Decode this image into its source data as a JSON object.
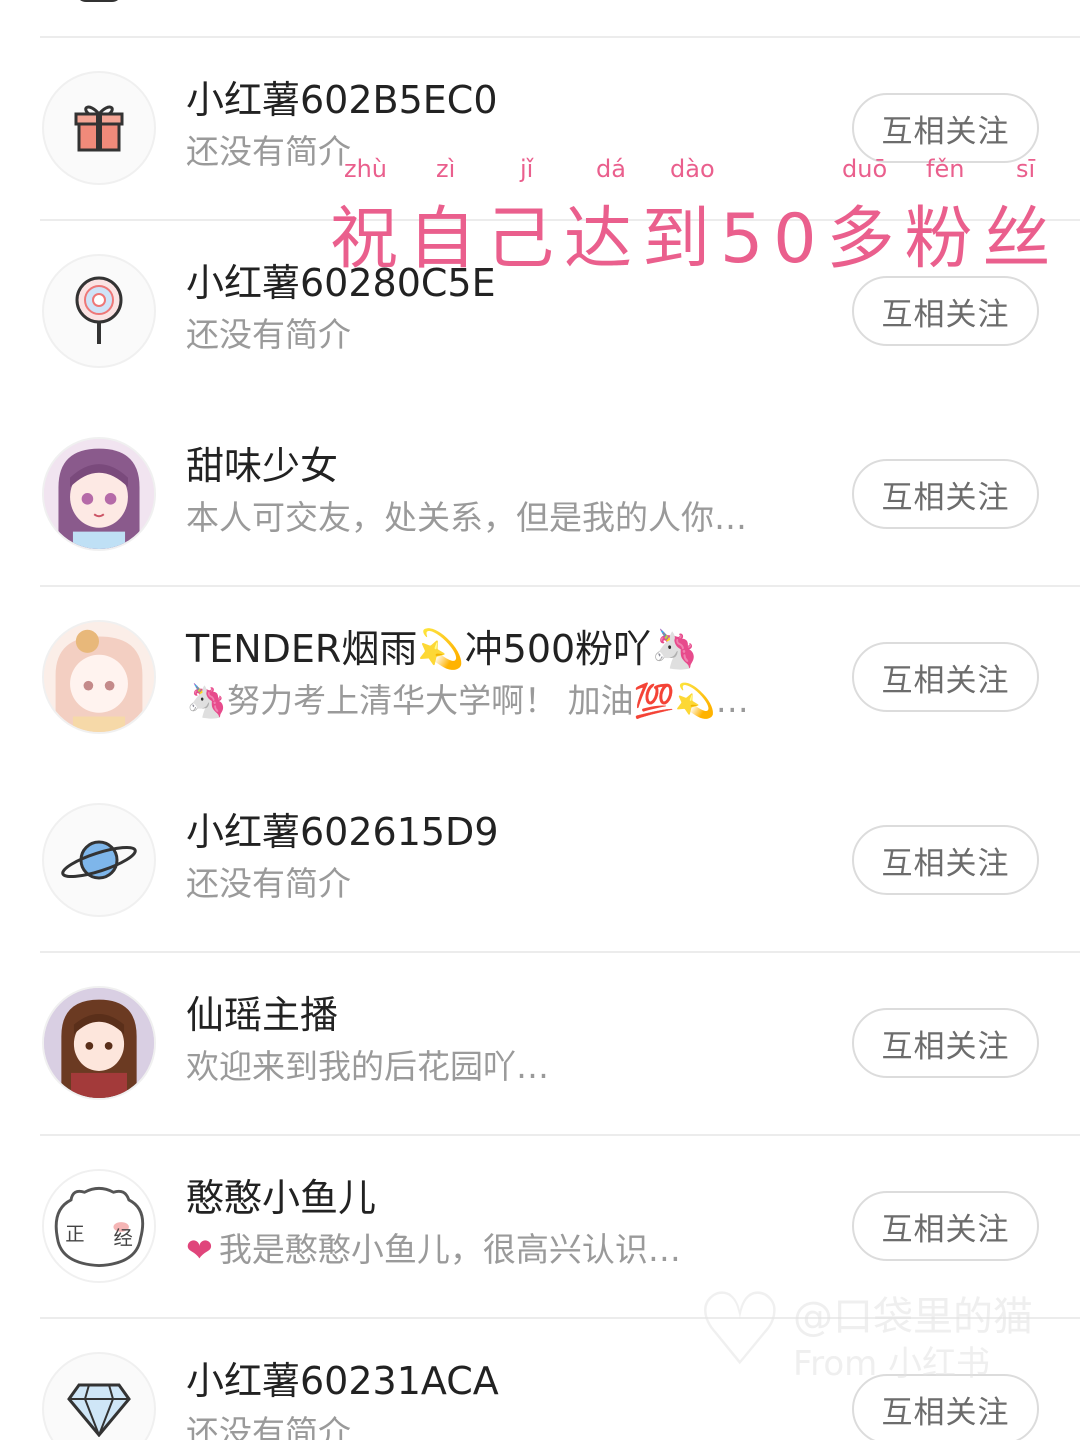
{
  "follow_label": "互相关注",
  "users": [
    {
      "name": "小红薯602B5EC0",
      "bio": "还没有简介",
      "avatar_icon": "gift-icon"
    },
    {
      "name": "小红薯60280C5E",
      "bio": "还没有简介",
      "avatar_icon": "lollipop-icon"
    },
    {
      "name": "甜味少女",
      "bio": "本人可交友，处关系，但是我的人你…",
      "avatar_icon": "anime-girl-avatar"
    },
    {
      "name": "TENDER烟雨💫冲500粉吖🦄",
      "bio": "🦄努力考上清华大学啊！ 加油💯💫…",
      "avatar_icon": "anime-girl-avatar"
    },
    {
      "name": "小红薯602615D9",
      "bio": "还没有简介",
      "avatar_icon": "planet-icon"
    },
    {
      "name": "仙瑶主播",
      "bio": "欢迎来到我的后花园吖…",
      "avatar_icon": "anime-girl-avatar"
    },
    {
      "name": "憨憨小鱼儿",
      "bio": "我是憨憨小鱼儿，很高兴认识…",
      "avatar_icon": "bear-sketch-avatar",
      "bio_prefix_icon": "heart-icon"
    },
    {
      "name": "小红薯60231ACA",
      "bio": "还没有简介",
      "avatar_icon": "diamond-icon"
    }
  ],
  "overlay": {
    "text": "祝自己达到50多粉丝",
    "pinyin": [
      "zhù",
      "zì",
      "jǐ",
      "dá",
      "dào",
      "duō",
      "fěn",
      "sī"
    ]
  },
  "watermark": {
    "line1": "@口袋里的猫",
    "line2": "From 小红书"
  },
  "colors": {
    "accent_pink": "#ea5f8d",
    "heart": "#e0457b",
    "divider": "#ececec",
    "button_border": "#dcdcdc"
  }
}
